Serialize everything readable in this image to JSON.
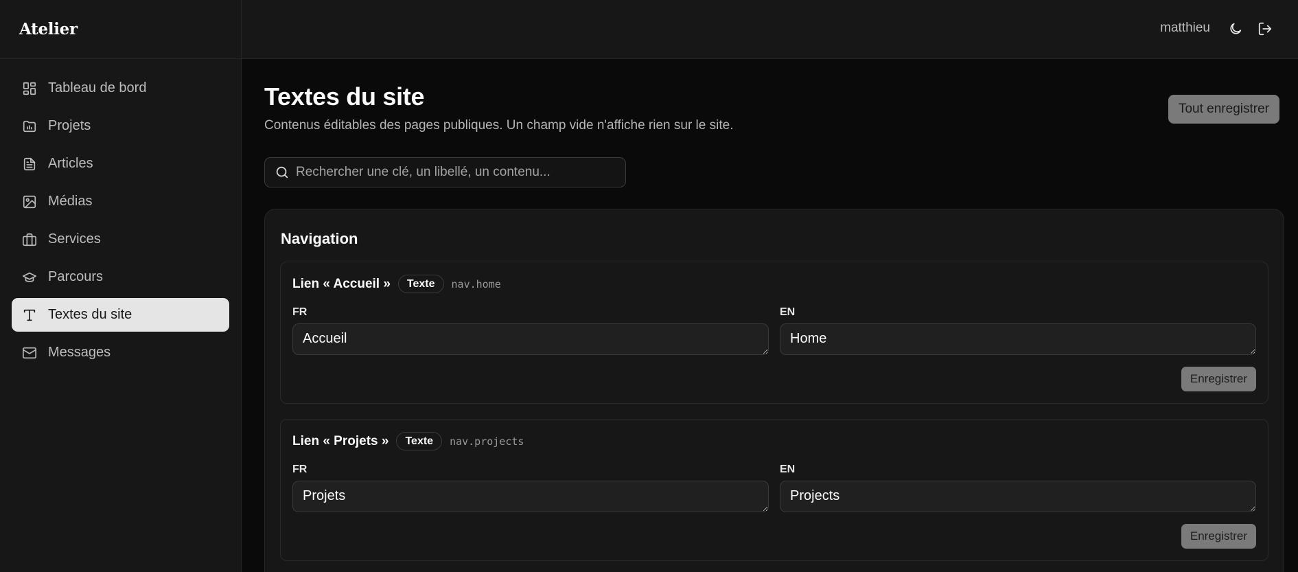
{
  "brand": {
    "name": "Atelier"
  },
  "sidebar": {
    "items": [
      {
        "label": "Tableau de bord",
        "icon": "dashboard-icon"
      },
      {
        "label": "Projets",
        "icon": "folder-icon"
      },
      {
        "label": "Articles",
        "icon": "file-text-icon"
      },
      {
        "label": "Médias",
        "icon": "image-icon"
      },
      {
        "label": "Services",
        "icon": "briefcase-icon"
      },
      {
        "label": "Parcours",
        "icon": "graduation-cap-icon"
      },
      {
        "label": "Textes du site",
        "icon": "type-icon",
        "active": true
      },
      {
        "label": "Messages",
        "icon": "mail-icon"
      }
    ]
  },
  "topbar": {
    "user": "matthieu",
    "theme_icon": "moon-icon",
    "logout_icon": "logout-icon"
  },
  "page": {
    "title": "Textes du site",
    "subtitle": "Contenus éditables des pages publiques. Un champ vide n'affiche rien sur le site.",
    "save_all_label": "Tout enregistrer"
  },
  "search": {
    "placeholder": "Rechercher une clé, un libellé, un contenu..."
  },
  "section": {
    "title": "Navigation",
    "entries": [
      {
        "label": "Lien « Accueil »",
        "type": "Texte",
        "key": "nav.home",
        "fr_label": "FR",
        "fr_value": "Accueil",
        "en_label": "EN",
        "en_value": "Home",
        "save_label": "Enregistrer"
      },
      {
        "label": "Lien « Projets »",
        "type": "Texte",
        "key": "nav.projects",
        "fr_label": "FR",
        "fr_value": "Projets",
        "en_label": "EN",
        "en_value": "Projects",
        "save_label": "Enregistrer"
      }
    ]
  },
  "colors": {
    "background": "#0a0a0a",
    "panel": "#171717",
    "active_nav": "#e5e5e5",
    "button_disabled": "#7a7a7a"
  }
}
